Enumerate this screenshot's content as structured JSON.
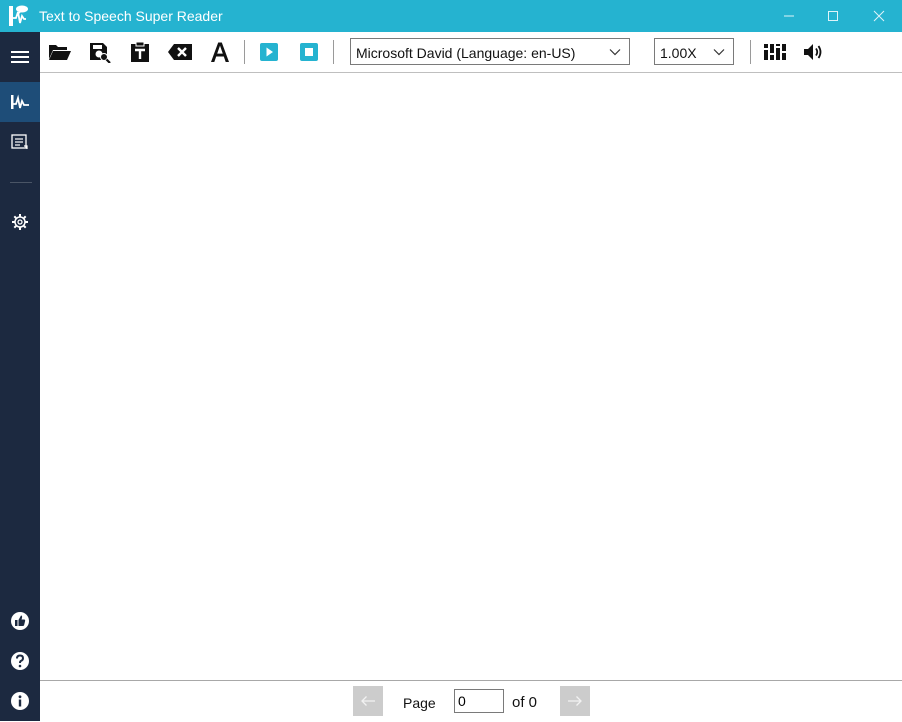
{
  "window": {
    "title": "Text to Speech Super Reader"
  },
  "sidebar": {
    "items": [
      {
        "name": "menu",
        "icon": "hamburger-icon"
      },
      {
        "name": "reader",
        "icon": "waveform-icon",
        "active": true
      },
      {
        "name": "documents",
        "icon": "list-icon"
      },
      {
        "name": "settings",
        "icon": "gear-icon"
      },
      {
        "name": "like",
        "icon": "thumbs-up-icon"
      },
      {
        "name": "help",
        "icon": "question-icon"
      },
      {
        "name": "about",
        "icon": "info-icon"
      }
    ]
  },
  "toolbar": {
    "voice": {
      "selected": "Microsoft David (Language: en-US)"
    },
    "speed": {
      "selected": "1.00X"
    },
    "accent_color": "#25b3d0"
  },
  "footer": {
    "page_label": "Page",
    "page_value": "0",
    "of_label": "of 0"
  },
  "colors": {
    "titlebar": "#25b3d0",
    "sidebar": "#1c2940",
    "sidebar_active": "#1e4d78"
  }
}
